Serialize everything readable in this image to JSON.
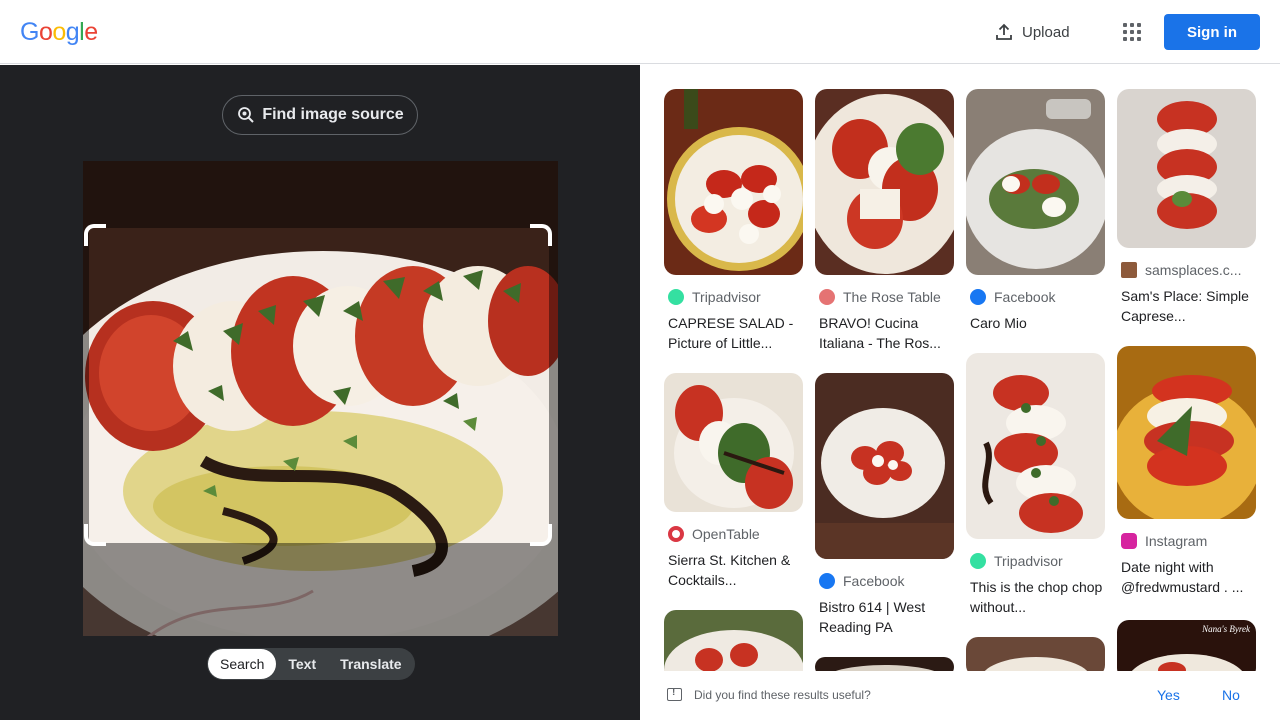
{
  "header": {
    "logo_letters": [
      "G",
      "o",
      "o",
      "g",
      "l",
      "e"
    ],
    "upload_label": "Upload",
    "apps_icon": "apps-grid-icon",
    "signin_label": "Sign in"
  },
  "lens": {
    "find_source_label": "Find image source",
    "modes": [
      "Search",
      "Text",
      "Translate"
    ],
    "active_mode": "Search"
  },
  "results": [
    {
      "source": "Tripadvisor",
      "favicon_color": "#34e0a1",
      "title": "CAPRESE SALAD - Picture of Little..."
    },
    {
      "source": "The Rose Table",
      "favicon_color": "#e57373",
      "title": "BRAVO! Cucina Italiana - The Ros..."
    },
    {
      "source": "Facebook",
      "favicon_color": "#1877f2",
      "title": "Caro Mio"
    },
    {
      "source": "samsplaces.c...",
      "favicon_color": "#8d5a3b",
      "title": "Sam's Place: Simple Caprese..."
    },
    {
      "source": "OpenTable",
      "favicon_color": "#da3743",
      "title": "Sierra St. Kitchen & Cocktails..."
    },
    {
      "source": "Facebook",
      "favicon_color": "#1877f2",
      "title": "Bistro 614 | West Reading PA"
    },
    {
      "source": "Tripadvisor",
      "favicon_color": "#34e0a1",
      "title": "This is the chop chop without..."
    },
    {
      "source": "Instagram",
      "favicon_color": "#d6249f",
      "title": "Date night with @fredwmustard . ..."
    }
  ],
  "overlay_text": "Nana's Byrek",
  "feedback": {
    "question": "Did you find these results useful?",
    "yes": "Yes",
    "no": "No"
  },
  "colors": {
    "accent": "#1a73e8",
    "panel_bg": "#202124"
  }
}
